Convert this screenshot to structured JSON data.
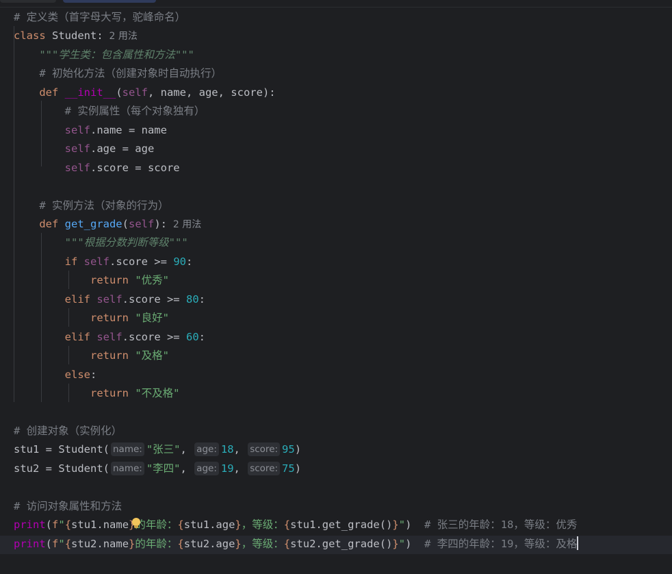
{
  "editor": {
    "lines": [
      {
        "t": [
          [
            "c-com",
            "# 定义类（首字母大写，驼峰命名）"
          ]
        ]
      },
      {
        "t": [
          [
            "c-kw",
            "class "
          ],
          [
            "c-txt",
            "Student:"
          ],
          [
            "c-usage",
            "  2 用法"
          ]
        ]
      },
      {
        "t": [
          [
            "c-txt",
            "    "
          ],
          [
            "c-doc",
            "\"\"\"学生类：包含属性和方法\"\"\""
          ]
        ]
      },
      {
        "t": [
          [
            "c-txt",
            "    "
          ],
          [
            "c-com",
            "# 初始化方法（创建对象时自动执行）"
          ]
        ]
      },
      {
        "t": [
          [
            "c-txt",
            "    "
          ],
          [
            "c-kw",
            "def "
          ],
          [
            "c-magic",
            "__init__"
          ],
          [
            "c-txt",
            "("
          ],
          [
            "c-self",
            "self"
          ],
          [
            "c-txt",
            ", name, age, score):"
          ]
        ]
      },
      {
        "t": [
          [
            "c-txt",
            "        "
          ],
          [
            "c-com",
            "# 实例属性（每个对象独有）"
          ]
        ]
      },
      {
        "t": [
          [
            "c-txt",
            "        "
          ],
          [
            "c-self",
            "self"
          ],
          [
            "c-txt",
            ".name = name"
          ]
        ]
      },
      {
        "t": [
          [
            "c-txt",
            "        "
          ],
          [
            "c-self",
            "self"
          ],
          [
            "c-txt",
            ".age = age"
          ]
        ]
      },
      {
        "t": [
          [
            "c-txt",
            "        "
          ],
          [
            "c-self",
            "self"
          ],
          [
            "c-txt",
            ".score = score"
          ]
        ]
      },
      {
        "t": []
      },
      {
        "t": [
          [
            "c-txt",
            "    "
          ],
          [
            "c-com",
            "# 实例方法（对象的行为）"
          ]
        ]
      },
      {
        "t": [
          [
            "c-txt",
            "    "
          ],
          [
            "c-kw",
            "def "
          ],
          [
            "c-fn",
            "get_grade"
          ],
          [
            "c-txt",
            "("
          ],
          [
            "c-self",
            "self"
          ],
          [
            "c-txt",
            "):"
          ],
          [
            "c-usage",
            "  2 用法"
          ]
        ]
      },
      {
        "t": [
          [
            "c-txt",
            "        "
          ],
          [
            "c-doc",
            "\"\"\"根据分数判断等级\"\"\""
          ]
        ]
      },
      {
        "t": [
          [
            "c-txt",
            "        "
          ],
          [
            "c-kw",
            "if "
          ],
          [
            "c-self",
            "self"
          ],
          [
            "c-txt",
            ".score >= "
          ],
          [
            "c-num",
            "90"
          ],
          [
            "c-txt",
            ":"
          ]
        ]
      },
      {
        "t": [
          [
            "c-txt",
            "            "
          ],
          [
            "c-kw",
            "return "
          ],
          [
            "c-str",
            "\"优秀\""
          ]
        ]
      },
      {
        "t": [
          [
            "c-txt",
            "        "
          ],
          [
            "c-kw",
            "elif "
          ],
          [
            "c-self",
            "self"
          ],
          [
            "c-txt",
            ".score >= "
          ],
          [
            "c-num",
            "80"
          ],
          [
            "c-txt",
            ":"
          ]
        ]
      },
      {
        "t": [
          [
            "c-txt",
            "            "
          ],
          [
            "c-kw",
            "return "
          ],
          [
            "c-str",
            "\"良好\""
          ]
        ]
      },
      {
        "t": [
          [
            "c-txt",
            "        "
          ],
          [
            "c-kw",
            "elif "
          ],
          [
            "c-self",
            "self"
          ],
          [
            "c-txt",
            ".score >= "
          ],
          [
            "c-num",
            "60"
          ],
          [
            "c-txt",
            ":"
          ]
        ]
      },
      {
        "t": [
          [
            "c-txt",
            "            "
          ],
          [
            "c-kw",
            "return "
          ],
          [
            "c-str",
            "\"及格\""
          ]
        ]
      },
      {
        "t": [
          [
            "c-txt",
            "        "
          ],
          [
            "c-kw",
            "else"
          ],
          [
            "c-txt",
            ":"
          ]
        ]
      },
      {
        "t": [
          [
            "c-txt",
            "            "
          ],
          [
            "c-kw",
            "return "
          ],
          [
            "c-str",
            "\"不及格\""
          ]
        ]
      },
      {
        "t": []
      },
      {
        "t": [
          [
            "c-com",
            "# 创建对象（实例化）"
          ]
        ]
      },
      {
        "t": [
          [
            "c-txt",
            "stu1 = Student("
          ],
          [
            "hint",
            "name:"
          ],
          [
            "c-str",
            "\"张三\""
          ],
          [
            "c-txt",
            ", "
          ],
          [
            "hint",
            "age:"
          ],
          [
            "c-num",
            "18"
          ],
          [
            "c-txt",
            ", "
          ],
          [
            "hint",
            "score:"
          ],
          [
            "c-num",
            "95"
          ],
          [
            "c-txt",
            ")"
          ]
        ]
      },
      {
        "t": [
          [
            "c-txt",
            "stu2 = Student("
          ],
          [
            "hint",
            "name:"
          ],
          [
            "c-str",
            "\"李四\""
          ],
          [
            "c-txt",
            ", "
          ],
          [
            "hint",
            "age:"
          ],
          [
            "c-num",
            "19"
          ],
          [
            "c-txt",
            ", "
          ],
          [
            "hint",
            "score:"
          ],
          [
            "c-num",
            "75"
          ],
          [
            "c-txt",
            ")"
          ]
        ]
      },
      {
        "t": []
      },
      {
        "t": [
          [
            "c-com",
            "# 访问对象属性和方法"
          ]
        ]
      },
      {
        "t": [
          [
            "c-magic",
            "print"
          ],
          [
            "c-txt",
            "("
          ],
          [
            "c-fstr",
            "f"
          ],
          [
            "c-str",
            "\""
          ],
          [
            "c-fstr",
            "{"
          ],
          [
            "c-txt",
            "stu1.name"
          ],
          [
            "c-fstr",
            "}"
          ],
          [
            "c-str",
            "的年龄："
          ],
          [
            "c-fstr",
            "{"
          ],
          [
            "c-txt",
            "stu1.age"
          ],
          [
            "c-fstr",
            "}"
          ],
          [
            "c-str",
            "，等级："
          ],
          [
            "c-fstr",
            "{"
          ],
          [
            "c-txt",
            "stu1.get_grade()"
          ],
          [
            "c-fstr",
            "}"
          ],
          [
            "c-str",
            "\""
          ],
          [
            "c-txt",
            ")  "
          ],
          [
            "c-com",
            "# 张三的年龄：18，等级：优秀"
          ]
        ]
      },
      {
        "t": [
          [
            "c-magic",
            "print"
          ],
          [
            "c-txt",
            "("
          ],
          [
            "c-fstr",
            "f"
          ],
          [
            "c-str",
            "\""
          ],
          [
            "c-fstr",
            "{"
          ],
          [
            "c-txt",
            "stu2.name"
          ],
          [
            "c-fstr",
            "}"
          ],
          [
            "c-str",
            "的年龄："
          ],
          [
            "c-fstr",
            "{"
          ],
          [
            "c-txt",
            "stu2.age"
          ],
          [
            "c-fstr",
            "}"
          ],
          [
            "c-str",
            "，等级："
          ],
          [
            "c-fstr",
            "{"
          ],
          [
            "c-txt",
            "stu2.get_grade()"
          ],
          [
            "c-fstr",
            "}"
          ],
          [
            "c-str",
            "\""
          ],
          [
            "c-txt",
            ")  "
          ],
          [
            "c-com",
            "# 李四的年龄：19，等级：及格"
          ],
          [
            "caret",
            ""
          ]
        ]
      }
    ]
  },
  "colors": {
    "background": "#1e1f22",
    "keyword": "#cf8e6d",
    "function": "#56a8f5",
    "self": "#94558d",
    "string": "#6aab73",
    "number": "#2aacb8",
    "comment": "#7a7e85"
  },
  "icons": {
    "intention_bulb": "lightbulb-icon"
  }
}
